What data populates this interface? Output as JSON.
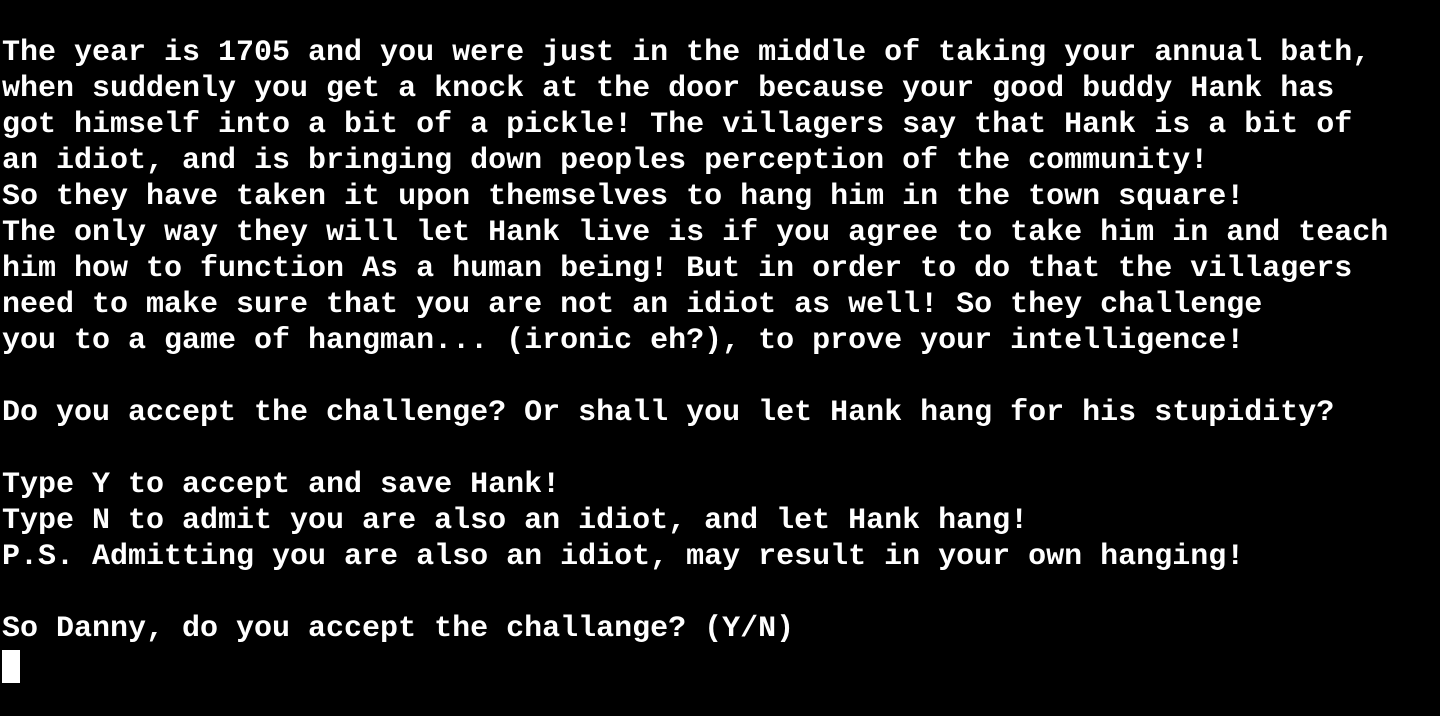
{
  "colors": {
    "background": "#000000",
    "text": "#ffffff",
    "cursor": "#ffffff"
  },
  "terminal": {
    "lines": [
      "The year is 1705 and you were just in the middle of taking your annual bath,",
      "when suddenly you get a knock at the door because your good buddy Hank has",
      "got himself into a bit of a pickle! The villagers say that Hank is a bit of",
      "an idiot, and is bringing down peoples perception of the community!",
      "So they have taken it upon themselves to hang him in the town square!",
      "The only way they will let Hank live is if you agree to take him in and teach",
      "him how to function As a human being! But in order to do that the villagers",
      "need to make sure that you are not an idiot as well! So they challenge",
      "you to a game of hangman... (ironic eh?), to prove your intelligence!",
      "",
      "Do you accept the challenge? Or shall you let Hank hang for his stupidity?",
      "",
      "Type Y to accept and save Hank!",
      "Type N to admit you are also an idiot, and let Hank hang!",
      "P.S. Admitting you are also an idiot, may result in your own hanging!",
      "",
      "So Danny, do you accept the challange? (Y/N)"
    ],
    "input_value": ""
  }
}
